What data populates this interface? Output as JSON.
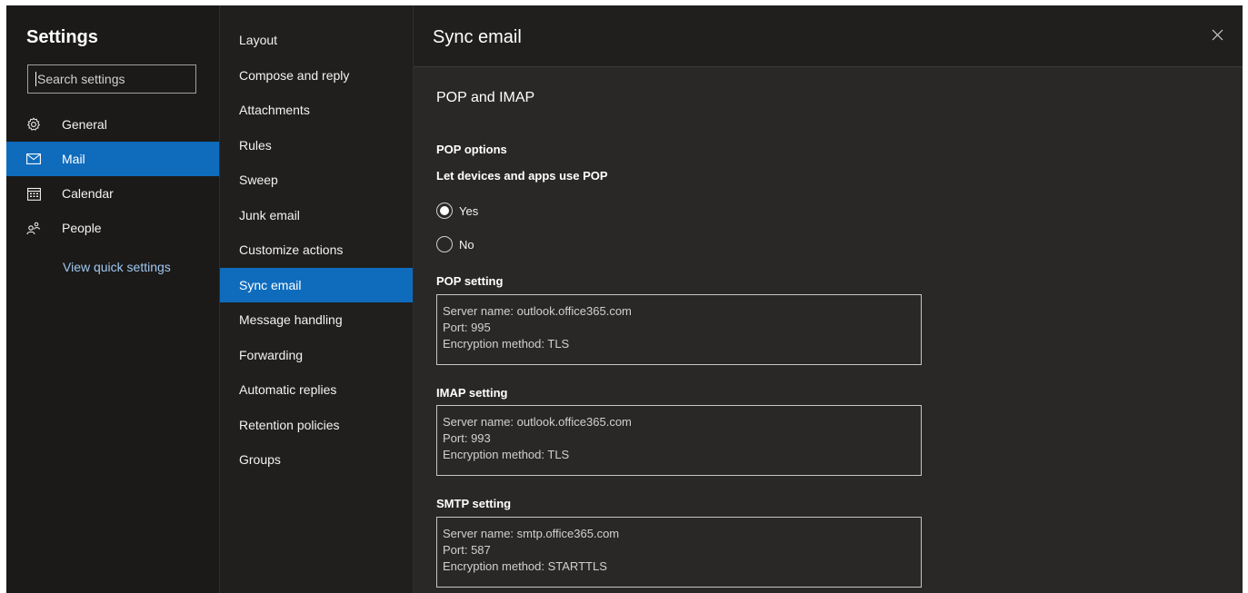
{
  "settings": {
    "title": "Settings",
    "search_placeholder": "Search settings"
  },
  "nav": {
    "items": [
      {
        "label": "General",
        "icon": "gear-icon"
      },
      {
        "label": "Mail",
        "icon": "mail-icon",
        "active": true
      },
      {
        "label": "Calendar",
        "icon": "calendar-icon"
      },
      {
        "label": "People",
        "icon": "people-icon"
      }
    ],
    "quick_settings_link": "View quick settings"
  },
  "subnav": {
    "items": [
      "Layout",
      "Compose and reply",
      "Attachments",
      "Rules",
      "Sweep",
      "Junk email",
      "Customize actions",
      "Sync email",
      "Message handling",
      "Forwarding",
      "Automatic replies",
      "Retention policies",
      "Groups"
    ],
    "active_index": 7
  },
  "panel": {
    "title": "Sync email",
    "close_icon": "close-icon",
    "section_title": "POP and IMAP",
    "pop_options_label": "POP options",
    "pop_question": "Let devices and apps use POP",
    "radio_yes": "Yes",
    "radio_no": "No",
    "radio_selected": "Yes",
    "pop_setting": {
      "label": "POP setting",
      "server": "Server name: outlook.office365.com",
      "port": "Port: 995",
      "encryption": "Encryption method: TLS"
    },
    "imap_setting": {
      "label": "IMAP setting",
      "server": "Server name: outlook.office365.com",
      "port": "Port: 993",
      "encryption": "Encryption method: TLS"
    },
    "smtp_setting": {
      "label": "SMTP setting",
      "server": "Server name: smtp.office365.com",
      "port": "Port: 587",
      "encryption": "Encryption method: STARTTLS"
    }
  },
  "colors": {
    "accent": "#0f6cbd",
    "link": "#9fc8f0",
    "background": "#1b1a19"
  }
}
